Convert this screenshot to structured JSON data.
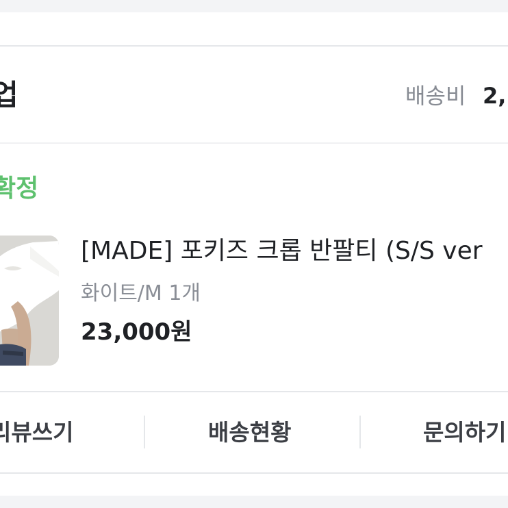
{
  "order": {
    "shop_name": "업",
    "shipping_label": "배송비",
    "shipping_value": "2,",
    "status": "확정"
  },
  "product": {
    "name": "[MADE] 포키즈 크롭 반팔티 (S/S ver",
    "option": "화이트/M 1개",
    "price": "23,000원"
  },
  "actions": {
    "review": "리뷰쓰기",
    "shipping_status": "배송현황",
    "inquiry": "문의하기"
  },
  "colors": {
    "status_green": "#5ec16e",
    "text_dark": "#1f2125",
    "text_gray": "#878b93",
    "divider": "#e5e7ea",
    "page_band": "#f3f4f6"
  },
  "icons": {
    "thumbnail": "product-photo-white-crop-tee"
  }
}
